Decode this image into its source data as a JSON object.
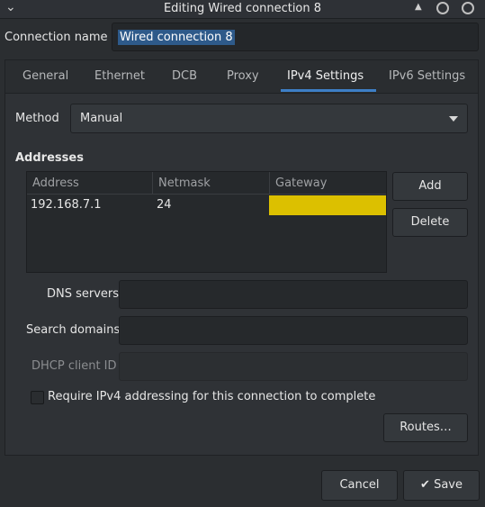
{
  "window": {
    "title": "Editing Wired connection 8"
  },
  "connection": {
    "label": "Connection name",
    "value": "Wired connection 8"
  },
  "tabs": [
    "General",
    "Ethernet",
    "DCB",
    "Proxy",
    "IPv4 Settings",
    "IPv6 Settings"
  ],
  "active_tab": "IPv4 Settings",
  "method": {
    "label": "Method",
    "value": "Manual"
  },
  "addresses": {
    "heading": "Addresses",
    "columns": [
      "Address",
      "Netmask",
      "Gateway"
    ],
    "rows": [
      {
        "address": "192.168.7.1",
        "netmask": "24",
        "gateway": ""
      }
    ],
    "add_label": "Add",
    "delete_label": "Delete"
  },
  "dns": {
    "label": "DNS servers",
    "value": ""
  },
  "search_domains": {
    "label": "Search domains",
    "value": ""
  },
  "dhcp_client_id": {
    "label": "DHCP client ID",
    "value": ""
  },
  "require_ipv4": {
    "label": "Require IPv4 addressing for this connection to complete",
    "checked": false
  },
  "routes_label": "Routes…",
  "footer": {
    "cancel_label": "Cancel",
    "save_label": "Save"
  },
  "colors": {
    "accent": "#3d7fc7",
    "gateway_highlight": "#dcc000",
    "selection": "#2e5a8a"
  },
  "icons": {
    "window_menu": "chevron-down-icon",
    "window_shade": "triangle-up-icon",
    "minimize": "circle-icon",
    "close": "circle-icon",
    "save": "check-icon",
    "method_dropdown": "dropdown-arrow-icon"
  }
}
